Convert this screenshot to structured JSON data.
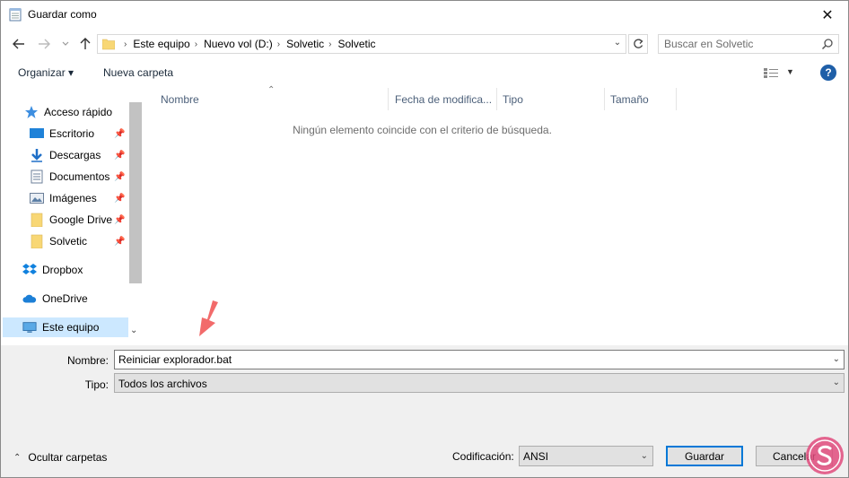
{
  "window": {
    "title": "Guardar como",
    "close_symbol": "✕"
  },
  "navigation": {
    "breadcrumbs": [
      "Este equipo",
      "Nuevo vol (D:)",
      "Solvetic",
      "Solvetic"
    ],
    "search_placeholder": "Buscar en Solvetic"
  },
  "toolbar": {
    "organize_label": "Organizar ▾",
    "new_folder_label": "Nueva carpeta",
    "help_label": "?"
  },
  "sidebar": {
    "quick_access": "Acceso rápido",
    "items": [
      {
        "label": "Escritorio",
        "icon": "desktop-icon",
        "pinned": true
      },
      {
        "label": "Descargas",
        "icon": "download-icon",
        "pinned": true
      },
      {
        "label": "Documentos",
        "icon": "document-icon",
        "pinned": true
      },
      {
        "label": "Imágenes",
        "icon": "image-icon",
        "pinned": true
      },
      {
        "label": "Google Drive",
        "icon": "folder-icon",
        "pinned": true
      },
      {
        "label": "Solvetic",
        "icon": "folder-icon",
        "pinned": true
      }
    ],
    "dropbox": "Dropbox",
    "onedrive": "OneDrive",
    "this_pc": "Este equipo"
  },
  "file_list": {
    "columns": [
      "Nombre",
      "Fecha de modifica...",
      "Tipo",
      "Tamaño"
    ],
    "empty_message": "Ningún elemento coincide con el criterio de búsqueda."
  },
  "form": {
    "name_label": "Nombre:",
    "name_value": "Reiniciar explorador.bat",
    "type_label": "Tipo:",
    "type_value": "Todos los archivos"
  },
  "footer": {
    "hide_folders_label": "Ocultar carpetas",
    "encoding_label": "Codificación:",
    "encoding_value": "ANSI",
    "save_label": "Guardar",
    "cancel_label": "Cancelar"
  },
  "colors": {
    "accent": "#0078d7",
    "selection": "#cce8ff",
    "annotation_arrow": "#f26b6b",
    "folder": "#f8d775"
  }
}
